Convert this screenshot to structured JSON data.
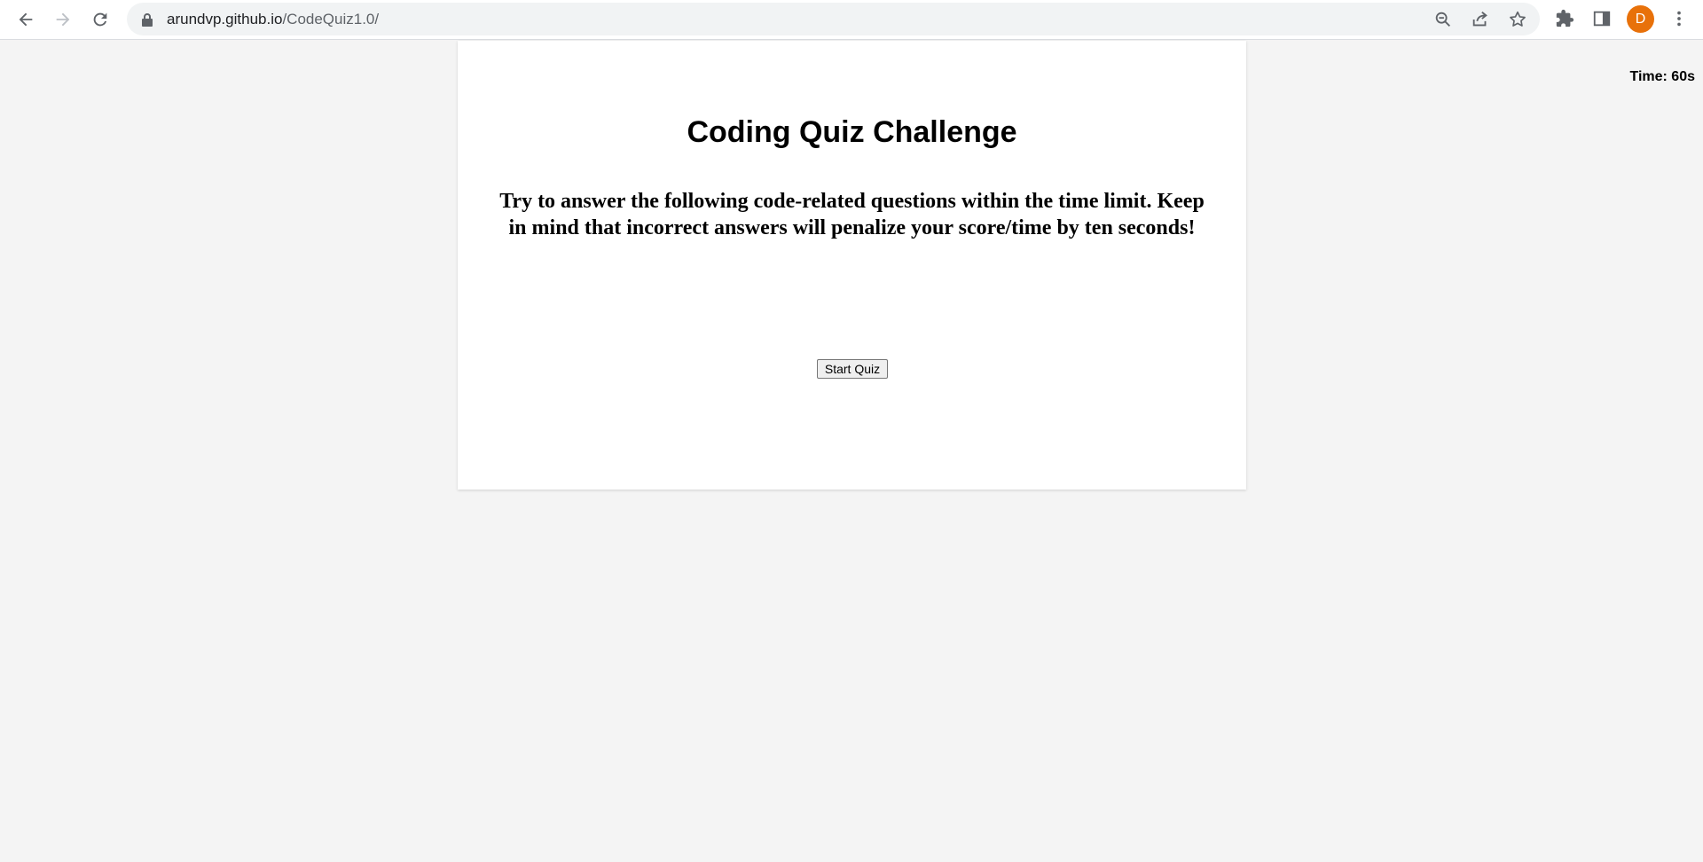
{
  "browser": {
    "url_host": "arundvp.github.io",
    "url_path": "/CodeQuiz1.0/",
    "profile_initial": "D",
    "profile_color": "#e8710a",
    "icons": [
      "back-arrow-icon",
      "forward-arrow-icon",
      "reload-icon",
      "lock-icon",
      "zoom-out-icon",
      "share-icon",
      "star-icon",
      "extensions-icon",
      "side-panel-icon",
      "more-menu-icon"
    ]
  },
  "timer": {
    "label": "Time: 60s"
  },
  "quiz": {
    "title": "Coding Quiz Challenge",
    "description": "Try to answer the following code-related questions within the time limit. Keep in mind that incorrect answers will penalize your score/time by ten seconds!",
    "start_label": "Start Quiz"
  }
}
